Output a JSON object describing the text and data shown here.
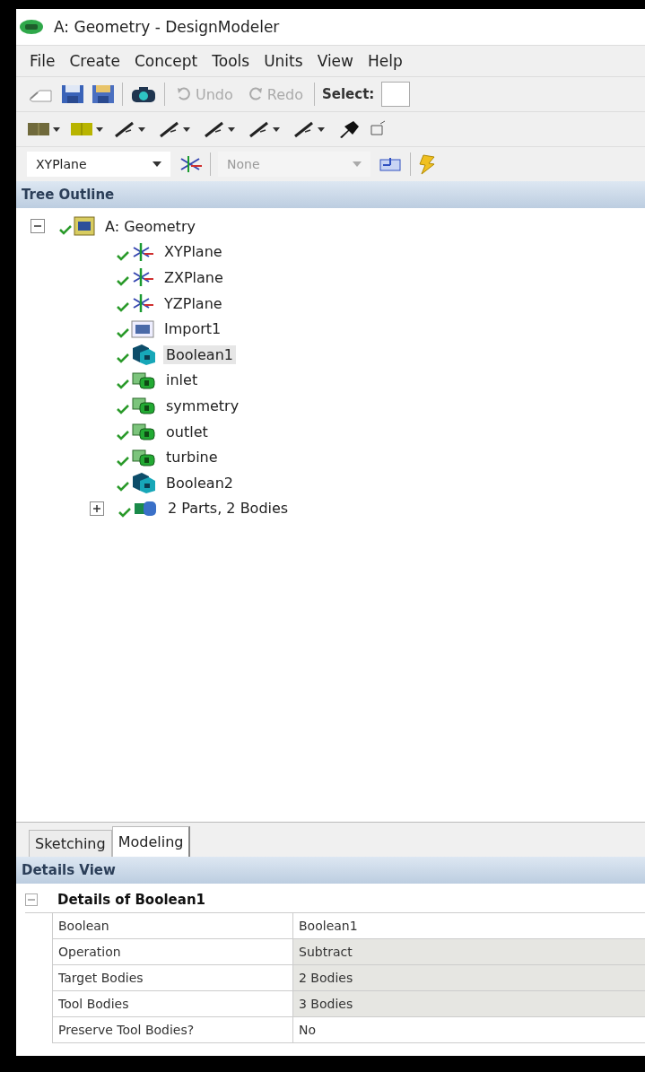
{
  "window": {
    "title": "A: Geometry - DesignModeler"
  },
  "menu": [
    "File",
    "Create",
    "Concept",
    "Tools",
    "Units",
    "View",
    "Help"
  ],
  "toolbar": {
    "undo": {
      "label": "Undo",
      "disabled": true
    },
    "redo": {
      "label": "Redo",
      "disabled": true
    },
    "select_label": "Select:"
  },
  "plane_toolbar": {
    "plane": "XYPlane",
    "sketch": {
      "value": "None",
      "disabled": true
    }
  },
  "tree_outline": {
    "title": "Tree Outline",
    "items": [
      {
        "label": "A: Geometry",
        "kind": "geometry",
        "expanded": true,
        "selected": false,
        "children": [
          {
            "label": "XYPlane",
            "kind": "plane",
            "selected": false
          },
          {
            "label": "ZXPlane",
            "kind": "plane",
            "selected": false
          },
          {
            "label": "YZPlane",
            "kind": "plane",
            "selected": false
          },
          {
            "label": "Import1",
            "kind": "import",
            "selected": false
          },
          {
            "label": "Boolean1",
            "kind": "boolean",
            "selected": true
          },
          {
            "label": "inlet",
            "kind": "selection",
            "selected": false
          },
          {
            "label": "symmetry",
            "kind": "selection",
            "selected": false
          },
          {
            "label": "outlet",
            "kind": "selection",
            "selected": false
          },
          {
            "label": "turbine",
            "kind": "selection",
            "selected": false
          },
          {
            "label": "Boolean2",
            "kind": "boolean",
            "selected": false
          },
          {
            "label": "2 Parts, 2 Bodies",
            "kind": "parts",
            "expanded": false,
            "selected": false
          }
        ]
      }
    ]
  },
  "tabs": [
    {
      "label": "Sketching",
      "selected": false
    },
    {
      "label": "Modeling",
      "selected": true
    }
  ],
  "details_view": {
    "title": "Details View",
    "group": {
      "label": "Details of Boolean1",
      "expanded": true
    },
    "rows": [
      {
        "property": "Boolean",
        "value": "Boolean1",
        "shaded": false
      },
      {
        "property": "Operation",
        "value": "Subtract",
        "shaded": true
      },
      {
        "property": "Target Bodies",
        "value": "2 Bodies",
        "shaded": true
      },
      {
        "property": "Tool Bodies",
        "value": "3 Bodies",
        "shaded": true
      },
      {
        "property": "Preserve Tool Bodies?",
        "value": "No",
        "shaded": false
      }
    ]
  }
}
